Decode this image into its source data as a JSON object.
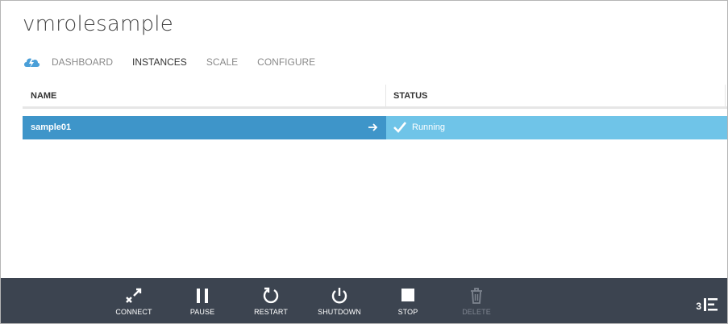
{
  "page": {
    "title": "vmrolesample"
  },
  "tabs": [
    {
      "label": "DASHBOARD",
      "active": false
    },
    {
      "label": "INSTANCES",
      "active": true
    },
    {
      "label": "SCALE",
      "active": false
    },
    {
      "label": "CONFIGURE",
      "active": false
    }
  ],
  "grid": {
    "columns": [
      "NAME",
      "STATUS"
    ],
    "rows": [
      {
        "name": "sample01",
        "status": "Running",
        "selected": true
      }
    ]
  },
  "commands": [
    {
      "label": "CONNECT",
      "icon": "connect-icon",
      "enabled": true
    },
    {
      "label": "PAUSE",
      "icon": "pause-icon",
      "enabled": true
    },
    {
      "label": "RESTART",
      "icon": "restart-icon",
      "enabled": true
    },
    {
      "label": "SHUTDOWN",
      "icon": "power-icon",
      "enabled": true
    },
    {
      "label": "STOP",
      "icon": "stop-icon",
      "enabled": true
    },
    {
      "label": "DELETE",
      "icon": "trash-icon",
      "enabled": false
    }
  ],
  "status_area": {
    "count": "3",
    "icon": "notification-stack-icon"
  },
  "colors": {
    "command_bar": "#3c4450",
    "row_selected_name": "#3e95c9",
    "row_selected_status": "#6fc4e8",
    "cloud_icon": "#4a9fd8"
  }
}
